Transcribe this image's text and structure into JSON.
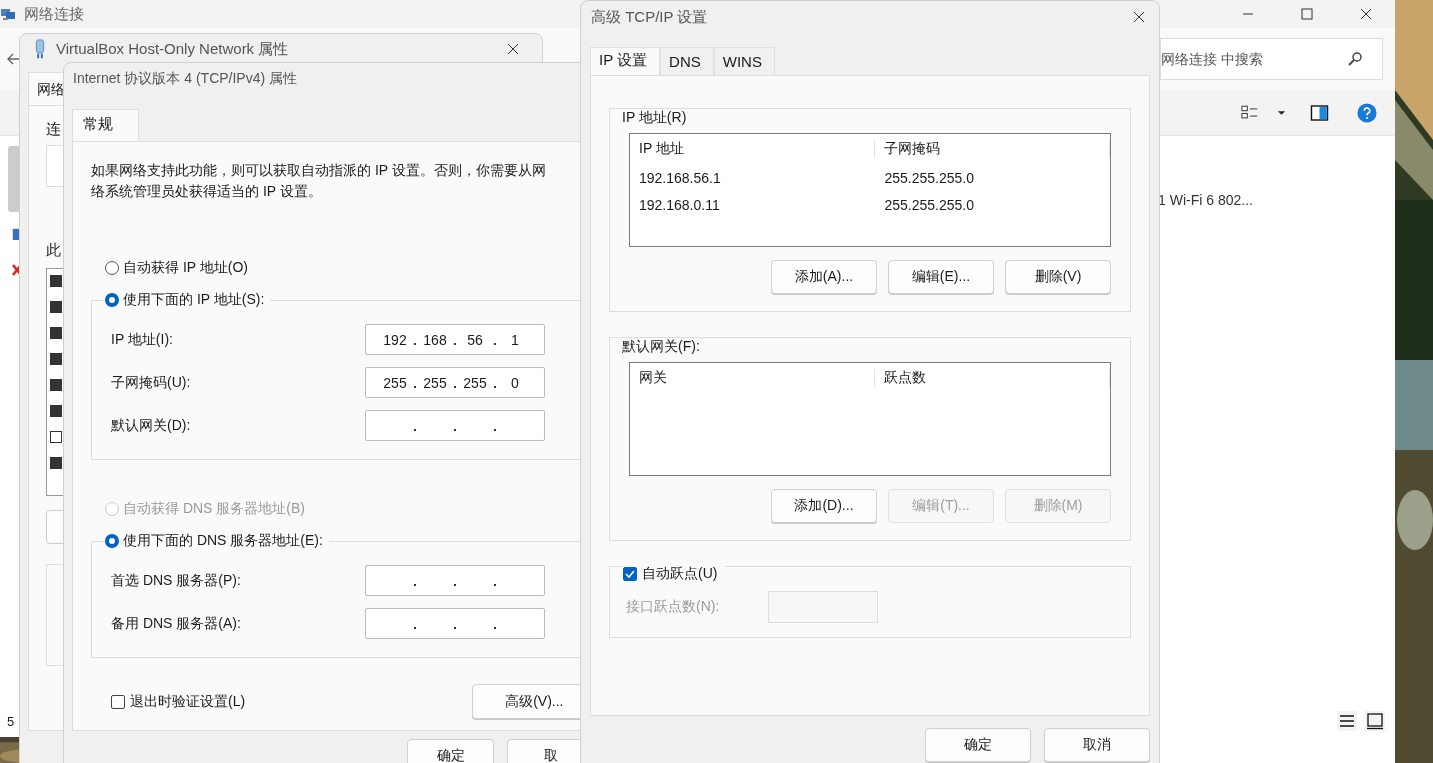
{
  "explorer": {
    "title": "网络连接",
    "search": {
      "placeholder": "网络连接 中搜索"
    },
    "item_text": "1 Wi-Fi 6 802...",
    "status_text": "5"
  },
  "adapter_window": {
    "title": "VirtualBox Host-Only Network 属性",
    "tab": "网络",
    "label_connect": "连",
    "label_items": "此",
    "components": [
      {
        "checked": true
      },
      {
        "checked": true
      },
      {
        "checked": true
      },
      {
        "checked": true
      },
      {
        "checked": true
      },
      {
        "checked": true
      },
      {
        "checked": false
      },
      {
        "checked": true
      }
    ]
  },
  "ipv4_window": {
    "title": "Internet 协议版本 4 (TCP/IPv4) 属性",
    "tabs": [
      {
        "label": "常规",
        "selected": true
      }
    ],
    "description": [
      "如果网络支持此功能，则可以获取自动指派的 IP 设置。否则，你需要从网",
      "络系统管理员处获得适当的 IP 设置。"
    ],
    "ip_options": [
      {
        "label": "自动获得 IP 地址(O)",
        "selected": false,
        "disabled": false
      },
      {
        "label": "使用下面的 IP 地址(S):",
        "selected": true,
        "disabled": false
      }
    ],
    "ip_fields": [
      {
        "label": "IP 地址(I):",
        "octets": [
          "192",
          "168",
          "56",
          "1"
        ]
      },
      {
        "label": "子网掩码(U):",
        "octets": [
          "255",
          "255",
          "255",
          "0"
        ]
      },
      {
        "label": "默认网关(D):"
      }
    ],
    "dns_options": [
      {
        "label": "自动获得 DNS 服务器地址(B)",
        "selected": false,
        "disabled": true
      },
      {
        "label": "使用下面的 DNS 服务器地址(E):",
        "selected": true,
        "disabled": false
      }
    ],
    "dns_fields": [
      {
        "label": "首选 DNS 服务器(P):"
      },
      {
        "label": "备用 DNS 服务器(A):"
      }
    ],
    "validate": {
      "label": "退出时验证设置(L)",
      "checked": false
    },
    "advanced_button": "高级(V)...",
    "buttons": [
      "确定",
      "取"
    ]
  },
  "advanced_window": {
    "title": "高级 TCP/IP 设置",
    "tabs": [
      {
        "label": "IP 设置",
        "selected": true
      },
      {
        "label": "DNS",
        "selected": false
      },
      {
        "label": "WINS",
        "selected": false
      }
    ],
    "groups": [
      {
        "title": "IP 地址(R)",
        "columns": [
          "IP 地址",
          "子网掩码"
        ],
        "rows": [
          [
            "192.168.56.1",
            "255.255.255.0"
          ],
          [
            "192.168.0.11",
            "255.255.255.0"
          ]
        ],
        "buttons": [
          {
            "label": "添加(A)...",
            "disabled": false
          },
          {
            "label": "编辑(E)...",
            "disabled": false
          },
          {
            "label": "删除(V)",
            "disabled": false
          }
        ]
      },
      {
        "title": "默认网关(F):",
        "columns": [
          "网关",
          "跃点数"
        ],
        "buttons": [
          {
            "label": "添加(D)...",
            "disabled": false
          },
          {
            "label": "编辑(T)...",
            "disabled": true
          },
          {
            "label": "删除(M)",
            "disabled": true
          }
        ]
      }
    ],
    "auto_metric": {
      "label": "自动跃点(U)",
      "checked": true
    },
    "interface_metric": {
      "label": "接口跃点数(N):",
      "disabled": true
    },
    "buttons": [
      "确定",
      "取消"
    ]
  }
}
